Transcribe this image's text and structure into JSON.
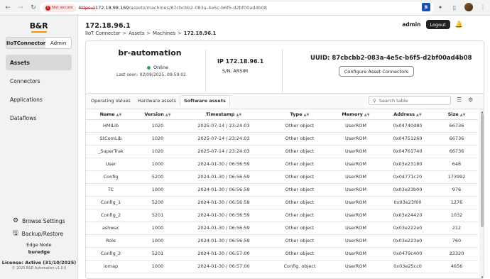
{
  "browser": {
    "security_label": "Not secure",
    "url_scheme": "https://",
    "url_host": "172.18.98.169",
    "url_path": "/assets/machines/87cbcbb2-083a-4e5c-b6f5-d2bf00ad4b08"
  },
  "sidebar": {
    "brand": "B&R",
    "app_tabs": [
      "IIoTConnector",
      "Admin"
    ],
    "items": [
      {
        "label": "Assets",
        "active": true
      },
      {
        "label": "Connectors",
        "active": false
      },
      {
        "label": "Applications",
        "active": false
      },
      {
        "label": "Dataflows",
        "active": false
      }
    ],
    "browse_settings": "Browse Settings",
    "backup_restore": "Backup/Restore",
    "edge_node_label": "Edge Node",
    "edge_node_name": "buredge",
    "license": "License: Active (31/10/2025)",
    "copyright": "© 2025 B&R Automation v1.0.0"
  },
  "header": {
    "title": "172.18.96.1",
    "breadcrumb": [
      "IIoT Connector",
      "Assets",
      "Machines",
      "172.18.96.1"
    ],
    "username": "admin",
    "logout_label": "Logout"
  },
  "machine": {
    "name": "br-automation",
    "status": "Online",
    "last_seen": "Last seen: 02/08/2025, 09:59:02",
    "ip": "IP 172.18.96.1",
    "serial": "S/N: ARSIM",
    "uuid": "UUID: 87cbcbb2-083a-4e5c-b6f5-d2bf00ad4b08",
    "configure_label": "Configure Asset Connectors"
  },
  "tabs": [
    "Operating Values",
    "Hardware assets",
    "Software assets"
  ],
  "search_placeholder": "Search table",
  "table": {
    "columns": [
      "Name",
      "Version",
      "Timestamp",
      "Type",
      "Memory",
      "Address",
      "Size"
    ],
    "rows": [
      [
        "HMILib",
        "1020",
        "2025-07-14 / 23:24:03",
        "Other object",
        "UserROM",
        "0x04740d80",
        "66736"
      ],
      [
        "StComLib",
        "1020",
        "2025-07-14 / 23:24:03",
        "Other object",
        "UserROM",
        "0x04751260",
        "66736"
      ],
      [
        "_SuperTrak",
        "1020",
        "2025-07-14 / 23:24:03",
        "Other object",
        "UserROM",
        "0x04761740",
        "66736"
      ],
      [
        "User",
        "1000",
        "2024-01-30 / 06:56:59",
        "Other object",
        "UserROM",
        "0x03e23180",
        "648"
      ],
      [
        "Config",
        "5200",
        "2024-01-30 / 06:56:59",
        "Other object",
        "UserROM",
        "0x04771c20",
        "173992"
      ],
      [
        "TC",
        "1000",
        "2024-01-30 / 06:56:59",
        "Other object",
        "UserROM",
        "0x03e23b00",
        "976"
      ],
      [
        "Config_1",
        "5200",
        "2024-01-30 / 06:56:59",
        "Other object",
        "UserROM",
        "0x03e23f00",
        "1276"
      ],
      [
        "Config_2",
        "5201",
        "2024-01-30 / 06:56:59",
        "Other object",
        "UserROM",
        "0x03e24420",
        "1032"
      ],
      [
        "ashwac",
        "1000",
        "2024-01-30 / 06:56:59",
        "Other object",
        "UserROM",
        "0x03e222e0",
        "212"
      ],
      [
        "Role",
        "1000",
        "2024-01-30 / 06:56:59",
        "Other object",
        "UserROM",
        "0x03e223e0",
        "760"
      ],
      [
        "Config_3",
        "5201",
        "2024-01-30 / 06:57:00",
        "Other object",
        "UserROM",
        "0x0479c400",
        "23320"
      ],
      [
        "iomap",
        "1000",
        "2024-01-30 / 06:57:00",
        "Config. object",
        "UserROM",
        "0x03e25cc0",
        "4656"
      ]
    ]
  }
}
